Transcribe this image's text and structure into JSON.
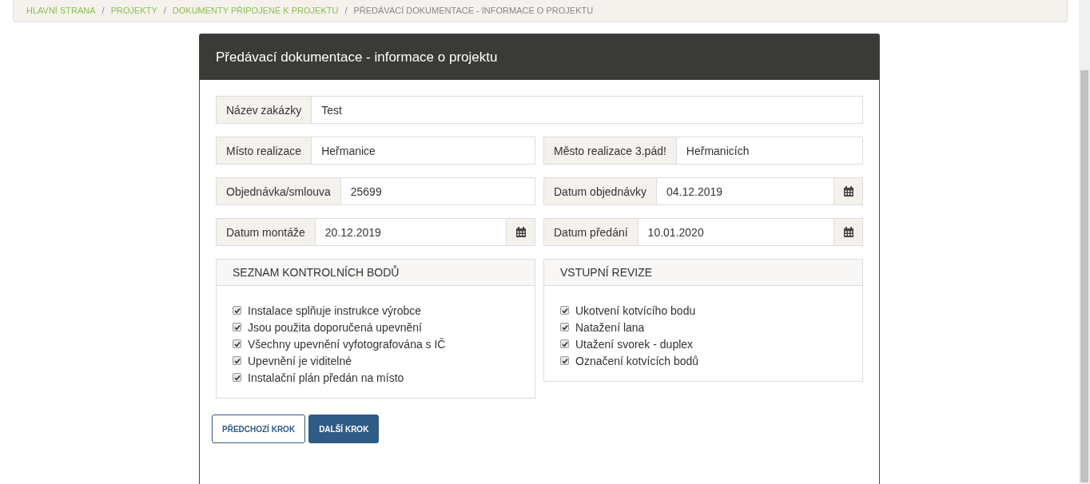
{
  "breadcrumb_separator": "/",
  "breadcrumb": [
    {
      "label": "HLAVNÍ STRANA",
      "kind": "link"
    },
    {
      "label": "PROJEKTY",
      "kind": "link"
    },
    {
      "label": "DOKUMENTY PŘIPOJENÉ K PROJEKTU",
      "kind": "link"
    },
    {
      "label": "PŘEDÁVACÍ DOKUMENTACE - INFORMACE O PROJEKTU",
      "kind": "current"
    }
  ],
  "card": {
    "title": "Předávací dokumentace - informace o projektu"
  },
  "field_rows": [
    [
      {
        "label": "Název zakázky",
        "value": "Test",
        "kind": "text"
      }
    ],
    [
      {
        "label": "Místo realizace",
        "value": "Heřmanice",
        "kind": "text"
      },
      {
        "label": "Město realizace 3.pád!",
        "value": "Heřmanicích",
        "kind": "text"
      }
    ],
    [
      {
        "label": "Objednávka/smlouva",
        "value": "25699",
        "kind": "text"
      },
      {
        "label": "Datum objednávky",
        "value": "04.12.2019",
        "kind": "date"
      }
    ],
    [
      {
        "label": "Datum montáže",
        "value": "20.12.2019",
        "kind": "date"
      },
      {
        "label": "Datum předání",
        "value": "10.01.2020",
        "kind": "date"
      }
    ]
  ],
  "checklists": [
    {
      "title": "SEZNAM KONTROLNÍCH BODŮ",
      "items": [
        {
          "label": "Instalace splňuje instrukce výrobce",
          "checked": true
        },
        {
          "label": "Jsou použita doporučená upevnění",
          "checked": true
        },
        {
          "label": "Všechny upevnění vyfotografována s IČ",
          "checked": true
        },
        {
          "label": "Upevnění je viditelné",
          "checked": true
        },
        {
          "label": "Instalační plán předán na místo",
          "checked": true
        }
      ]
    },
    {
      "title": "VSTUPNÍ REVIZE",
      "items": [
        {
          "label": "Ukotvení kotvícího bodu",
          "checked": true
        },
        {
          "label": "Natažení lana",
          "checked": true
        },
        {
          "label": "Utažení svorek - duplex",
          "checked": true
        },
        {
          "label": "Označení kotvících bodů",
          "checked": true
        }
      ]
    }
  ],
  "buttons": [
    {
      "label": "PŘEDCHOZÍ KROK",
      "kind": "secondary"
    },
    {
      "label": "DALŠÍ KROK",
      "kind": "primary"
    }
  ]
}
